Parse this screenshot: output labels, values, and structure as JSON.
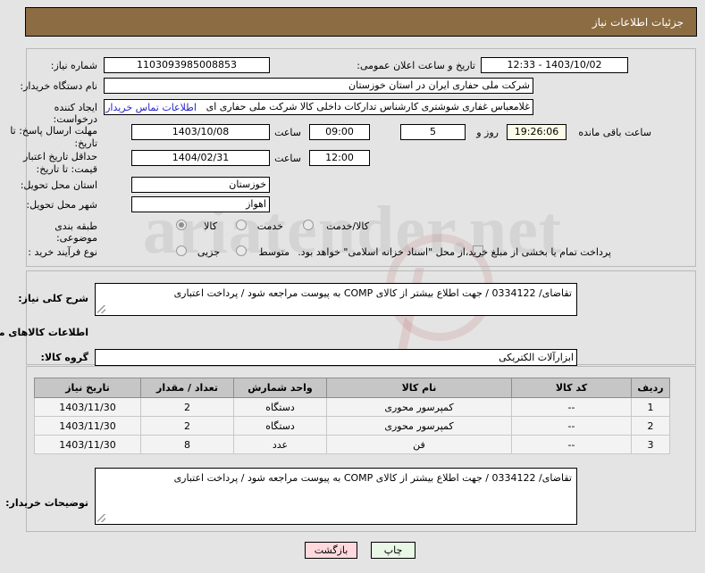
{
  "header": {
    "title": "جزئیات اطلاعات نیاز"
  },
  "watermark": {
    "text": "ariatender.net"
  },
  "form": {
    "need_number": {
      "label": "شماره نیاز:",
      "value": "1103093985008853"
    },
    "announce_datetime": {
      "label": "تاریخ و ساعت اعلان عمومی:",
      "value": "1403/10/02 - 12:33"
    },
    "buyer_org": {
      "label": "نام دستگاه خریدار:",
      "value": "شرکت ملی حفاری ایران در استان خوزستان"
    },
    "requester": {
      "label": "ایجاد کننده درخواست:",
      "value": "غلامعباس غفاری شوشتری کارشناس تدارکات داخلی کالا شرکت ملی حفاری ای"
    },
    "buyer_contact_link": "اطلاعات تماس خریدار",
    "response_deadline": {
      "label": "مهلت ارسال پاسخ: تا تاریخ:",
      "date": "1403/10/08",
      "time_label": "ساعت",
      "time": "09:00",
      "days_value": "5",
      "days_label": "روز و",
      "countdown": "19:26:06",
      "countdown_label": "ساعت باقی مانده"
    },
    "price_validity": {
      "label": "حداقل تاریخ اعتبار قیمت: تا تاریخ:",
      "date": "1404/02/31",
      "time_label": "ساعت",
      "time": "12:00"
    },
    "delivery_province": {
      "label": "استان محل تحویل:",
      "value": "خوزستان"
    },
    "delivery_city": {
      "label": "شهر محل تحویل:",
      "value": "اهواز"
    },
    "subject_category": {
      "label": "طبقه بندی موضوعی:",
      "options": [
        "کالا",
        "خدمت",
        "کالا/خدمت"
      ],
      "selected": "کالا"
    },
    "purchase_type": {
      "label": "نوع فرآیند خرید :",
      "options": [
        "جزیی",
        "متوسط"
      ],
      "selected": ""
    },
    "treasury_note": {
      "text": "پرداخت تمام یا بخشی از مبلغ خرید،از محل \"اسناد خزانه اسلامی\" خواهد بود.",
      "checked": false
    }
  },
  "summary": {
    "label": "شرح کلی نیاز:",
    "value": "تقاضای/ 0334122 / جهت اطلاع بیشتر از کالای  COMP  به پیوست مراجعه شود / پرداخت اعتباری"
  },
  "goods_section": {
    "title": "اطلاعات کالاهای مورد نیاز",
    "group": {
      "label": "گروه کالا:",
      "value": "ابزارآلات الکتریکی"
    },
    "table": {
      "columns": [
        "ردیف",
        "کد کالا",
        "نام کالا",
        "واحد شمارش",
        "تعداد / مقدار",
        "تاریخ نیاز"
      ],
      "rows": [
        {
          "row": "1",
          "code": "--",
          "name": "کمپرسور محوری",
          "unit": "دستگاه",
          "qty": "2",
          "date": "1403/11/30"
        },
        {
          "row": "2",
          "code": "--",
          "name": "کمپرسور محوری",
          "unit": "دستگاه",
          "qty": "2",
          "date": "1403/11/30"
        },
        {
          "row": "3",
          "code": "--",
          "name": "فن",
          "unit": "عدد",
          "qty": "8",
          "date": "1403/11/30"
        }
      ]
    },
    "notes": {
      "label": "توضیحات خریدار:",
      "value": "تقاضای/ 0334122 / جهت اطلاع بیشتر از کالای  COMP  به پیوست مراجعه شود / پرداخت اعتباری"
    }
  },
  "footer": {
    "back_button": "بازگشت",
    "print_button": "چاپ"
  }
}
